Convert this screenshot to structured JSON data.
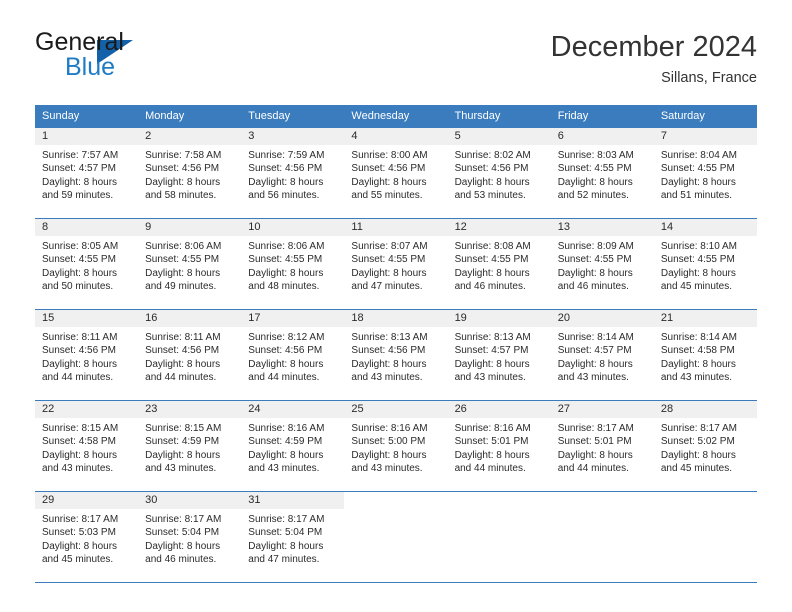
{
  "brand": {
    "name_part1": "General",
    "name_part2": "Blue",
    "logo_icon": "blue-triangle-icon"
  },
  "header": {
    "month_title": "December 2024",
    "location": "Sillans, France"
  },
  "calendar": {
    "weekday_headers": [
      "Sunday",
      "Monday",
      "Tuesday",
      "Wednesday",
      "Thursday",
      "Friday",
      "Saturday"
    ],
    "accent_color": "#3a7cbe",
    "daynum_bg": "#f0f0f0",
    "weeks": [
      [
        {
          "day": "1",
          "sunrise": "Sunrise: 7:57 AM",
          "sunset": "Sunset: 4:57 PM",
          "daylight_line1": "Daylight: 8 hours",
          "daylight_line2": "and 59 minutes."
        },
        {
          "day": "2",
          "sunrise": "Sunrise: 7:58 AM",
          "sunset": "Sunset: 4:56 PM",
          "daylight_line1": "Daylight: 8 hours",
          "daylight_line2": "and 58 minutes."
        },
        {
          "day": "3",
          "sunrise": "Sunrise: 7:59 AM",
          "sunset": "Sunset: 4:56 PM",
          "daylight_line1": "Daylight: 8 hours",
          "daylight_line2": "and 56 minutes."
        },
        {
          "day": "4",
          "sunrise": "Sunrise: 8:00 AM",
          "sunset": "Sunset: 4:56 PM",
          "daylight_line1": "Daylight: 8 hours",
          "daylight_line2": "and 55 minutes."
        },
        {
          "day": "5",
          "sunrise": "Sunrise: 8:02 AM",
          "sunset": "Sunset: 4:56 PM",
          "daylight_line1": "Daylight: 8 hours",
          "daylight_line2": "and 53 minutes."
        },
        {
          "day": "6",
          "sunrise": "Sunrise: 8:03 AM",
          "sunset": "Sunset: 4:55 PM",
          "daylight_line1": "Daylight: 8 hours",
          "daylight_line2": "and 52 minutes."
        },
        {
          "day": "7",
          "sunrise": "Sunrise: 8:04 AM",
          "sunset": "Sunset: 4:55 PM",
          "daylight_line1": "Daylight: 8 hours",
          "daylight_line2": "and 51 minutes."
        }
      ],
      [
        {
          "day": "8",
          "sunrise": "Sunrise: 8:05 AM",
          "sunset": "Sunset: 4:55 PM",
          "daylight_line1": "Daylight: 8 hours",
          "daylight_line2": "and 50 minutes."
        },
        {
          "day": "9",
          "sunrise": "Sunrise: 8:06 AM",
          "sunset": "Sunset: 4:55 PM",
          "daylight_line1": "Daylight: 8 hours",
          "daylight_line2": "and 49 minutes."
        },
        {
          "day": "10",
          "sunrise": "Sunrise: 8:06 AM",
          "sunset": "Sunset: 4:55 PM",
          "daylight_line1": "Daylight: 8 hours",
          "daylight_line2": "and 48 minutes."
        },
        {
          "day": "11",
          "sunrise": "Sunrise: 8:07 AM",
          "sunset": "Sunset: 4:55 PM",
          "daylight_line1": "Daylight: 8 hours",
          "daylight_line2": "and 47 minutes."
        },
        {
          "day": "12",
          "sunrise": "Sunrise: 8:08 AM",
          "sunset": "Sunset: 4:55 PM",
          "daylight_line1": "Daylight: 8 hours",
          "daylight_line2": "and 46 minutes."
        },
        {
          "day": "13",
          "sunrise": "Sunrise: 8:09 AM",
          "sunset": "Sunset: 4:55 PM",
          "daylight_line1": "Daylight: 8 hours",
          "daylight_line2": "and 46 minutes."
        },
        {
          "day": "14",
          "sunrise": "Sunrise: 8:10 AM",
          "sunset": "Sunset: 4:55 PM",
          "daylight_line1": "Daylight: 8 hours",
          "daylight_line2": "and 45 minutes."
        }
      ],
      [
        {
          "day": "15",
          "sunrise": "Sunrise: 8:11 AM",
          "sunset": "Sunset: 4:56 PM",
          "daylight_line1": "Daylight: 8 hours",
          "daylight_line2": "and 44 minutes."
        },
        {
          "day": "16",
          "sunrise": "Sunrise: 8:11 AM",
          "sunset": "Sunset: 4:56 PM",
          "daylight_line1": "Daylight: 8 hours",
          "daylight_line2": "and 44 minutes."
        },
        {
          "day": "17",
          "sunrise": "Sunrise: 8:12 AM",
          "sunset": "Sunset: 4:56 PM",
          "daylight_line1": "Daylight: 8 hours",
          "daylight_line2": "and 44 minutes."
        },
        {
          "day": "18",
          "sunrise": "Sunrise: 8:13 AM",
          "sunset": "Sunset: 4:56 PM",
          "daylight_line1": "Daylight: 8 hours",
          "daylight_line2": "and 43 minutes."
        },
        {
          "day": "19",
          "sunrise": "Sunrise: 8:13 AM",
          "sunset": "Sunset: 4:57 PM",
          "daylight_line1": "Daylight: 8 hours",
          "daylight_line2": "and 43 minutes."
        },
        {
          "day": "20",
          "sunrise": "Sunrise: 8:14 AM",
          "sunset": "Sunset: 4:57 PM",
          "daylight_line1": "Daylight: 8 hours",
          "daylight_line2": "and 43 minutes."
        },
        {
          "day": "21",
          "sunrise": "Sunrise: 8:14 AM",
          "sunset": "Sunset: 4:58 PM",
          "daylight_line1": "Daylight: 8 hours",
          "daylight_line2": "and 43 minutes."
        }
      ],
      [
        {
          "day": "22",
          "sunrise": "Sunrise: 8:15 AM",
          "sunset": "Sunset: 4:58 PM",
          "daylight_line1": "Daylight: 8 hours",
          "daylight_line2": "and 43 minutes."
        },
        {
          "day": "23",
          "sunrise": "Sunrise: 8:15 AM",
          "sunset": "Sunset: 4:59 PM",
          "daylight_line1": "Daylight: 8 hours",
          "daylight_line2": "and 43 minutes."
        },
        {
          "day": "24",
          "sunrise": "Sunrise: 8:16 AM",
          "sunset": "Sunset: 4:59 PM",
          "daylight_line1": "Daylight: 8 hours",
          "daylight_line2": "and 43 minutes."
        },
        {
          "day": "25",
          "sunrise": "Sunrise: 8:16 AM",
          "sunset": "Sunset: 5:00 PM",
          "daylight_line1": "Daylight: 8 hours",
          "daylight_line2": "and 43 minutes."
        },
        {
          "day": "26",
          "sunrise": "Sunrise: 8:16 AM",
          "sunset": "Sunset: 5:01 PM",
          "daylight_line1": "Daylight: 8 hours",
          "daylight_line2": "and 44 minutes."
        },
        {
          "day": "27",
          "sunrise": "Sunrise: 8:17 AM",
          "sunset": "Sunset: 5:01 PM",
          "daylight_line1": "Daylight: 8 hours",
          "daylight_line2": "and 44 minutes."
        },
        {
          "day": "28",
          "sunrise": "Sunrise: 8:17 AM",
          "sunset": "Sunset: 5:02 PM",
          "daylight_line1": "Daylight: 8 hours",
          "daylight_line2": "and 45 minutes."
        }
      ],
      [
        {
          "day": "29",
          "sunrise": "Sunrise: 8:17 AM",
          "sunset": "Sunset: 5:03 PM",
          "daylight_line1": "Daylight: 8 hours",
          "daylight_line2": "and 45 minutes."
        },
        {
          "day": "30",
          "sunrise": "Sunrise: 8:17 AM",
          "sunset": "Sunset: 5:04 PM",
          "daylight_line1": "Daylight: 8 hours",
          "daylight_line2": "and 46 minutes."
        },
        {
          "day": "31",
          "sunrise": "Sunrise: 8:17 AM",
          "sunset": "Sunset: 5:04 PM",
          "daylight_line1": "Daylight: 8 hours",
          "daylight_line2": "and 47 minutes."
        },
        {
          "day": "",
          "sunrise": "",
          "sunset": "",
          "daylight_line1": "",
          "daylight_line2": ""
        },
        {
          "day": "",
          "sunrise": "",
          "sunset": "",
          "daylight_line1": "",
          "daylight_line2": ""
        },
        {
          "day": "",
          "sunrise": "",
          "sunset": "",
          "daylight_line1": "",
          "daylight_line2": ""
        },
        {
          "day": "",
          "sunrise": "",
          "sunset": "",
          "daylight_line1": "",
          "daylight_line2": ""
        }
      ]
    ]
  }
}
